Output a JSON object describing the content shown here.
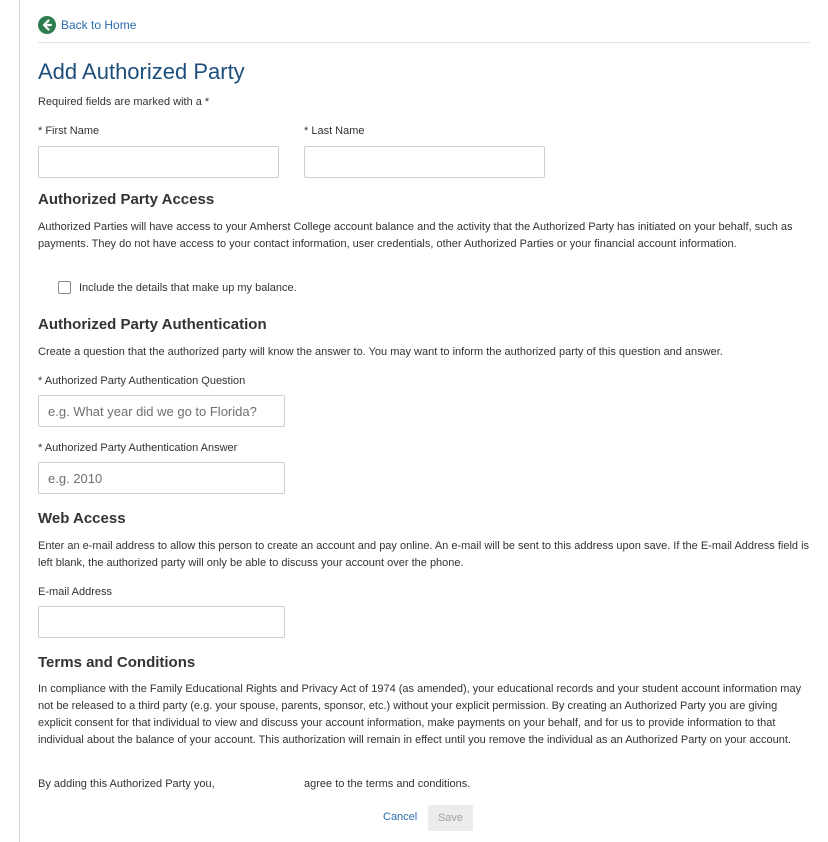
{
  "nav": {
    "back_label": "Back to Home"
  },
  "header": {
    "title": "Add Authorized Party",
    "required_note": "Required fields are marked with a *"
  },
  "name_fields": {
    "first_label": "* First Name",
    "last_label": "* Last Name",
    "first_value": "",
    "last_value": ""
  },
  "access": {
    "heading": "Authorized Party Access",
    "description": "Authorized Parties will have access to your Amherst College account balance and the activity that the Authorized Party has initiated on your behalf, such as payments. They do not have access to your contact information, user credentials, other Authorized Parties or your financial account information.",
    "checkbox_label": "Include the details that make up my balance.",
    "checkbox_checked": false
  },
  "authentication": {
    "heading": "Authorized Party Authentication",
    "description": "Create a question that the authorized party will know the answer to. You may want to inform the authorized party of this question and answer.",
    "question_label": "* Authorized Party Authentication Question",
    "question_placeholder": "e.g. What year did we go to Florida?",
    "answer_label": "* Authorized Party Authentication Answer",
    "answer_placeholder": "e.g. 2010"
  },
  "web_access": {
    "heading": "Web Access",
    "description": "Enter an e-mail address to allow this person to create an account and pay online. An e-mail will be sent to this address upon save. If the E-mail Address field is left blank, the authorized party will only be able to discuss your account over the phone.",
    "email_label": "E-mail Address",
    "email_value": ""
  },
  "terms": {
    "heading": "Terms and Conditions",
    "body": "In compliance with the Family Educational Rights and Privacy Act of 1974 (as amended), your educational records and your student account information may not be released to a third party (e.g. your spouse, parents, sponsor, etc.) without your explicit permission. By creating an Authorized Party you are giving explicit consent for that individual to view and discuss your account information, make payments on your behalf, and for us to provide information to that individual about the balance of your account. This authorization will remain in effect until you remove the individual as an Authorized Party on your account.",
    "agree_prefix": "By adding this Authorized Party you,",
    "agree_suffix": "agree to the terms and conditions."
  },
  "actions": {
    "cancel_label": "Cancel",
    "save_label": "Save"
  },
  "colors": {
    "title": "#1e4f7c",
    "link": "#2a6db0",
    "back_icon": "#2e7d4f",
    "disabled_button_bg": "#ececec"
  }
}
